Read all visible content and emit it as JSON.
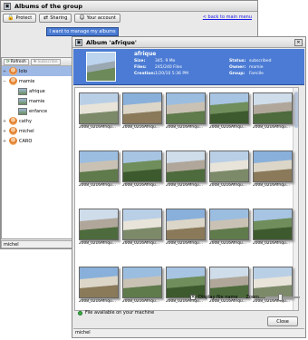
{
  "w1": {
    "title": "Albums of the group",
    "buttons": {
      "protect": "Protect",
      "sharing": "Sharing",
      "your_account": "Your account"
    },
    "back_link": "< back to main menu",
    "banner": "I want to manage my albums",
    "left": {
      "refresh": "Refresh",
      "subscribe": "Subscribe"
    },
    "tree": [
      {
        "label": "lolo",
        "type": "person",
        "selected": true,
        "tw": "+"
      },
      {
        "label": "mamie",
        "type": "person",
        "tw": "−"
      },
      {
        "label": "afrique",
        "type": "album",
        "indent": true
      },
      {
        "label": "mamie",
        "type": "album",
        "indent": true
      },
      {
        "label": "enfance",
        "type": "album",
        "indent": true
      },
      {
        "label": "cathy",
        "type": "person",
        "tw": "+"
      },
      {
        "label": "michel",
        "type": "person",
        "tw": "+"
      },
      {
        "label": "CARO",
        "type": "person",
        "tw": "+"
      }
    ],
    "status": "michel"
  },
  "w2": {
    "title": "Album 'afrique'",
    "album_name": "afrique",
    "size_label": "Size:",
    "size": "345. 9 Mo",
    "files_label": "Files:",
    "files": "245/240 Files",
    "creation_label": "Creation:",
    "creation": "1/20/10 5:36 PM",
    "status_label": "Status:",
    "status": "subscribed",
    "owner_label": "Owner:",
    "owner": "mamie",
    "group_label": "Group:",
    "group": "Famille",
    "display_file_name": "Display file name",
    "zoom": "Zoom",
    "available": "File available on your machine",
    "close": "Close",
    "statusbar": "michel",
    "photos": [
      "2008_0216Afriqu...",
      "2008_0216Afriqu...",
      "2008_0216Afriqu...",
      "2008_0216Afriqu...",
      "2008_0216Afriqu...",
      "2008_0216Afriqu...",
      "2008_0216Afriqu...",
      "2008_0216Afriqu...",
      "2008_0216Afriqu...",
      "2008_0216Afriqu...",
      "2008_0216Afriqu...",
      "2008_0216Afriqu...",
      "2008_0216Afriqu...",
      "2008_0216Afriqu...",
      "2008_0216Afriqu...",
      "2008_0216Afriqu...",
      "2008_0216Afriqu...",
      "2008_0216Afriqu...",
      "2008_0216Afriqu...",
      "2008_0216Afriqu..."
    ]
  }
}
